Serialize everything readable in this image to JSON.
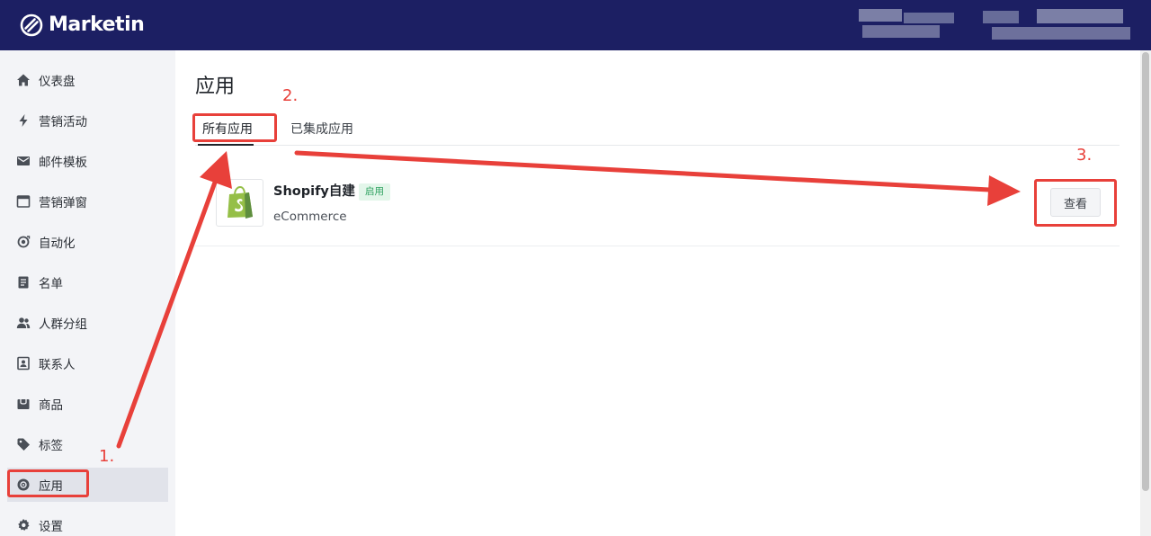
{
  "app": {
    "name": "Marketin",
    "brand_color": "#1c1f63",
    "accent_color": "#e8403a"
  },
  "sidebar": {
    "items": [
      {
        "label": "仪表盘",
        "icon": "home-icon"
      },
      {
        "label": "营销活动",
        "icon": "lightning-icon"
      },
      {
        "label": "邮件模板",
        "icon": "mail-icon"
      },
      {
        "label": "营销弹窗",
        "icon": "popup-window-icon"
      },
      {
        "label": "自动化",
        "icon": "automation-icon"
      },
      {
        "label": "名单",
        "icon": "list-document-icon"
      },
      {
        "label": "人群分组",
        "icon": "people-icon"
      },
      {
        "label": "联系人",
        "icon": "contact-card-icon"
      },
      {
        "label": "商品",
        "icon": "product-box-icon"
      },
      {
        "label": "标签",
        "icon": "tag-icon"
      },
      {
        "label": "应用",
        "icon": "apps-icon",
        "active": true
      },
      {
        "label": "设置",
        "icon": "gear-icon"
      }
    ]
  },
  "main": {
    "title": "应用",
    "tabs": [
      {
        "label": "所有应用",
        "active": true
      },
      {
        "label": "已集成应用",
        "active": false
      }
    ],
    "apps": [
      {
        "name": "Shopify自建",
        "status": "启用",
        "category": "eCommerce",
        "icon": "shopify-bag-icon",
        "action_label": "查看"
      }
    ]
  },
  "annotations": {
    "step1": "1.",
    "step2": "2.",
    "step3": "3."
  }
}
